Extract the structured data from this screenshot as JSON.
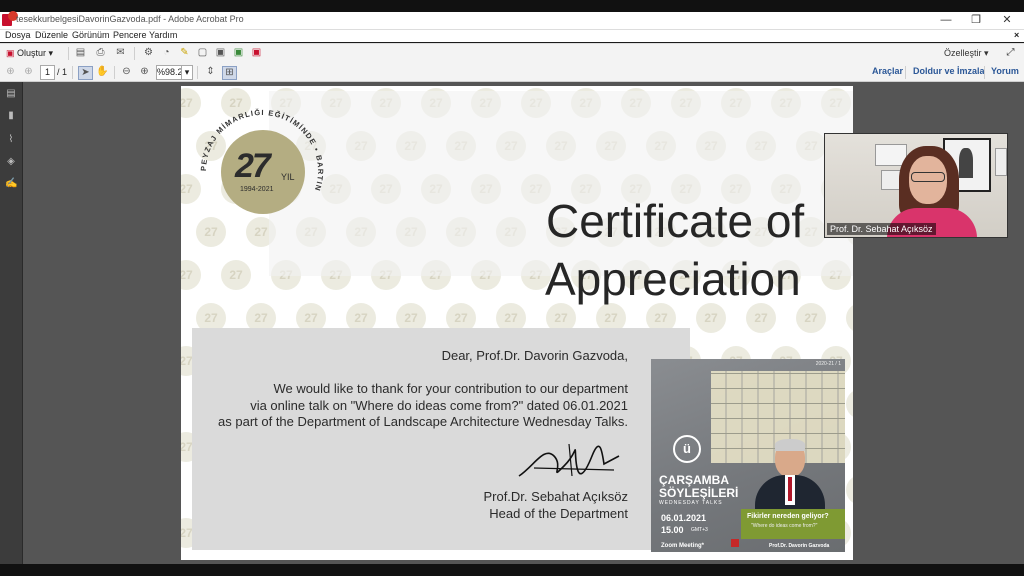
{
  "window": {
    "title": "tesekkurbelgesiDavorinGazvoda.pdf - Adobe Acrobat Pro",
    "minimize": "—",
    "maximize": "❐",
    "close": "✕"
  },
  "menubar": {
    "items": [
      "Dosya",
      "Düzenle",
      "Görünüm",
      "Pencere",
      "Yardım"
    ],
    "close": "×"
  },
  "toolbar1": {
    "create_label": "Oluştur",
    "customize_label": "Özelleştir"
  },
  "toolbar2": {
    "page_current": "1",
    "page_total": "/ 1",
    "zoom": "%98.2",
    "tools_link": "Araçlar",
    "sign_link": "Doldur ve İmzala",
    "comment_link": "Yorum"
  },
  "certificate": {
    "title_line1": "Certificate of",
    "title_line2": "Appreciation",
    "greeting": "Dear, Prof.Dr. Davorin Gazvoda,",
    "body_line1": "We would like to thank for your contribution to our department",
    "body_line2": "via online talk on \"Where do ideas come from?\" dated 06.01.2021",
    "body_line3": "as part of the Department of Landscape Architecture Wednesday Talks.",
    "signer_name": "Prof.Dr. Sebahat Açıksöz",
    "signer_title": "Head of the Department",
    "emblem": {
      "number": "27",
      "yil": "YIL",
      "years": "1994-2021",
      "ring_text": "PEYZAJ MİMARLIĞI EĞİTİMİNDE • BARTIN"
    },
    "watermark": "27"
  },
  "poster": {
    "term": "2020-21 / 1",
    "series_title_1": "ÇARŞAMBA",
    "series_title_2": "SÖYLEŞİLERİ",
    "series_sub": "WEDNESDAY TALKS",
    "date": "06.01.2021",
    "time": "15.00",
    "tz": "GMT+3",
    "platform": "Zoom Meeting*",
    "talk_title": "Fikirler nereden geliyor?",
    "talk_subtitle": "\"Where do ideas come from?\"",
    "speaker": "Prof.Dr. Davorin Gazvoda"
  },
  "video": {
    "participant_name": "Prof. Dr. Sebahat Açıksöz"
  },
  "colors": {
    "accent_link": "#2b5797",
    "emblem_gold": "#b4ad82",
    "poster_green": "#8aa33a",
    "poster_grey": "#7d8084"
  }
}
